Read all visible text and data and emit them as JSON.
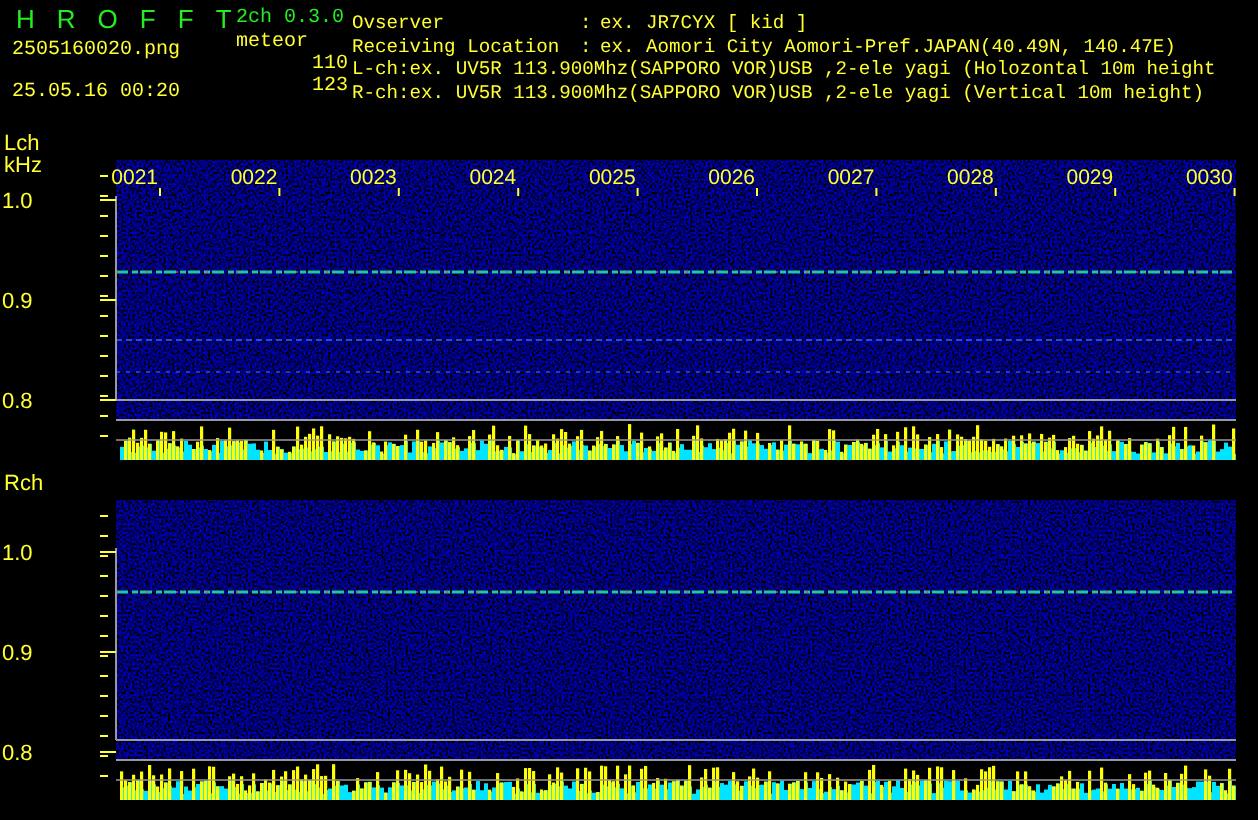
{
  "app": {
    "title_letters": [
      "H",
      "R",
      "O",
      "F",
      "F",
      "T"
    ],
    "version": "2ch 0.3.0",
    "mode": "meteor",
    "filename": "2505160020.png",
    "timestamp": "25.05.16 00:20"
  },
  "info": [
    {
      "kind": "field",
      "label": "Ovserver",
      "colon": ":",
      "value": "ex. JR7CYX [ kid ]"
    },
    {
      "kind": "field",
      "label": "Receiving Location",
      "colon": ":",
      "value": "ex. Aomori City Aomori-Pref.JAPAN(40.49N, 140.47E)"
    },
    {
      "kind": "line",
      "text": "L-ch:ex. UV5R 113.900Mhz(SAPPORO VOR)USB ,2-ele yagi (Holozontal 10m height"
    },
    {
      "kind": "line",
      "text": "R-ch:ex. UV5R 113.900Mhz(SAPPORO VOR)USB ,2-ele yagi (Vertical 10m height)"
    }
  ],
  "channels": [
    {
      "name": "Lch",
      "unit": "kHz",
      "count": "110",
      "time_labels": [
        "0021",
        "0022",
        "0023",
        "0024",
        "0025",
        "0026",
        "0027",
        "0028",
        "0029",
        "0030"
      ],
      "yticks": [
        "1.0",
        "0.9",
        "0.8"
      ]
    },
    {
      "name": "Rch",
      "count": "123",
      "yticks": [
        "1.0",
        "0.9",
        "0.8"
      ]
    }
  ]
}
